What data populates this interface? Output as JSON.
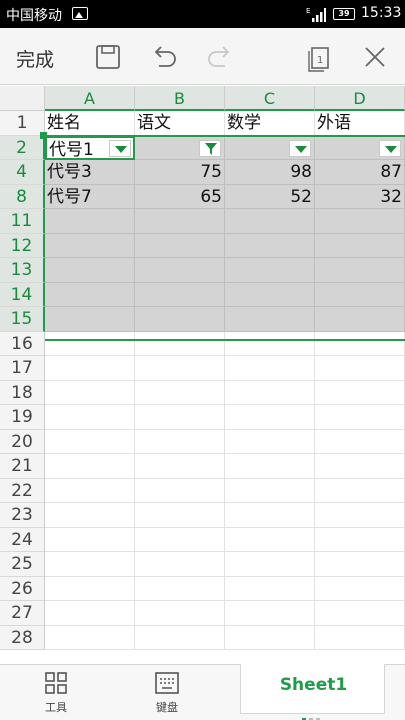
{
  "status_bar": {
    "carrier": "中国移动",
    "network": "E",
    "battery": "39",
    "time": "15:33"
  },
  "toolbar": {
    "done_label": "完成",
    "page_badge": "1",
    "icons": [
      "save-icon",
      "undo-icon",
      "redo-icon",
      "page-view-icon",
      "close-icon"
    ]
  },
  "columns": [
    "A",
    "B",
    "C",
    "D"
  ],
  "rows": [
    {
      "num": "1",
      "cells": [
        "姓名",
        "语文",
        "数学",
        "外语"
      ]
    },
    {
      "num": "2",
      "cells": [
        "代号1",
        "",
        "",
        ""
      ]
    },
    {
      "num": "4",
      "cells": [
        "代号3",
        "75",
        "98",
        "87"
      ]
    },
    {
      "num": "8",
      "cells": [
        "代号7",
        "65",
        "52",
        "32"
      ]
    },
    {
      "num": "11",
      "cells": [
        "",
        "",
        "",
        ""
      ]
    },
    {
      "num": "12",
      "cells": [
        "",
        "",
        "",
        ""
      ]
    },
    {
      "num": "13",
      "cells": [
        "",
        "",
        "",
        ""
      ]
    },
    {
      "num": "14",
      "cells": [
        "",
        "",
        "",
        ""
      ]
    },
    {
      "num": "15",
      "cells": [
        "",
        "",
        "",
        ""
      ]
    },
    {
      "num": "16",
      "cells": [
        "",
        "",
        "",
        ""
      ]
    },
    {
      "num": "17",
      "cells": [
        "",
        "",
        "",
        ""
      ]
    },
    {
      "num": "18",
      "cells": [
        "",
        "",
        "",
        ""
      ]
    },
    {
      "num": "19",
      "cells": [
        "",
        "",
        "",
        ""
      ]
    },
    {
      "num": "20",
      "cells": [
        "",
        "",
        "",
        ""
      ]
    },
    {
      "num": "21",
      "cells": [
        "",
        "",
        "",
        ""
      ]
    },
    {
      "num": "22",
      "cells": [
        "",
        "",
        "",
        ""
      ]
    },
    {
      "num": "23",
      "cells": [
        "",
        "",
        "",
        ""
      ]
    },
    {
      "num": "24",
      "cells": [
        "",
        "",
        "",
        ""
      ]
    },
    {
      "num": "25",
      "cells": [
        "",
        "",
        "",
        ""
      ]
    },
    {
      "num": "26",
      "cells": [
        "",
        "",
        "",
        ""
      ]
    },
    {
      "num": "27",
      "cells": [
        "",
        "",
        "",
        ""
      ]
    },
    {
      "num": "28",
      "cells": [
        "",
        "",
        "",
        ""
      ]
    }
  ],
  "filter_active_column": "B",
  "bottom_bar": {
    "tools_label": "工具",
    "keyboard_label": "键盘",
    "sheet_label": "Sheet1"
  },
  "colors": {
    "accent": "#1f9b49",
    "selection": "#d4d4d4"
  }
}
